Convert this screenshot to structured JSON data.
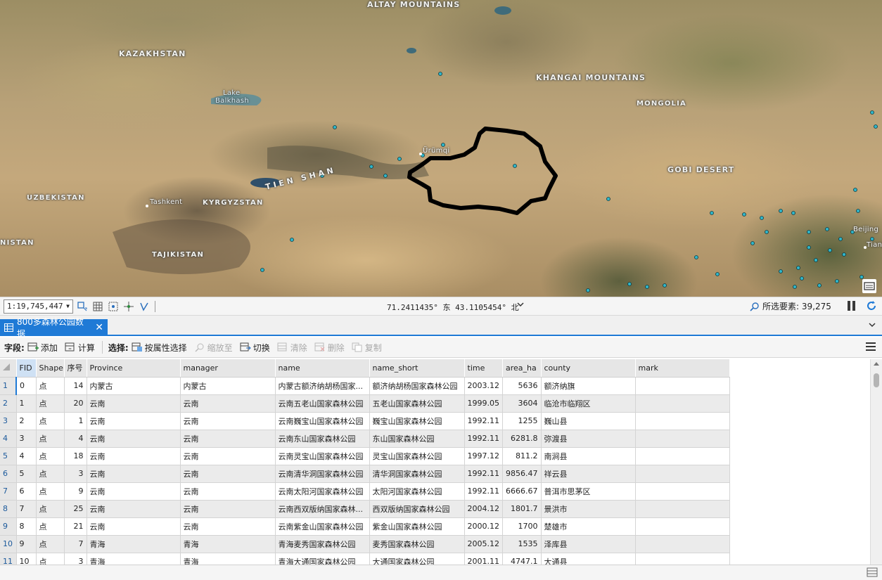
{
  "map": {
    "labels": {
      "altay": "ALTAY MOUNTAINS",
      "kazakhstan": "KAZAKHSTAN",
      "lake_balkhash_1": "Lake",
      "lake_balkhash_2": "Balkhash",
      "khangai": "KHANGAI MOUNTAINS",
      "mongolia": "MONGOLIA",
      "urumqi": "Ürümqi",
      "gobi": "GOBI DESERT",
      "uzbekistan": "UZBEKISTAN",
      "tashkent": "Tashkent",
      "kyrgyzstan": "KYRGYZSTAN",
      "tien_shan": "TIEN SHAN",
      "nistan": "NISTAN",
      "tajikistan": "TAJIKISTAN",
      "beijing": "Beijing",
      "tianjin": "Tianj"
    },
    "point_color": "#2fb6c9",
    "outline_color": "#000000"
  },
  "statusbar": {
    "scale": "1:19,745,447",
    "coordinates": "71.2411435° 东 43.1105454° 北",
    "selected_label": "所选要素: 39,275",
    "icons": [
      "map-layout-icon",
      "grid-icon",
      "snapping-icon",
      "guides-icon",
      "correction-icon"
    ]
  },
  "tab": {
    "title": "800多森林公园数据"
  },
  "toolbar": {
    "fields_label": "字段:",
    "add": "添加",
    "calculate": "计算",
    "select_label": "选择:",
    "select_by_attr": "按属性选择",
    "zoom_to": "缩放至",
    "switch": "切换",
    "clear": "清除",
    "delete": "删除",
    "copy": "复制"
  },
  "table": {
    "columns": [
      "FID",
      "Shape",
      "序号",
      "Province",
      "manager",
      "name",
      "name_short",
      "time",
      "area_ha",
      "county",
      "mark"
    ],
    "rows": [
      [
        "1",
        "0",
        "点",
        "14",
        "内蒙古",
        "内蒙古",
        "内蒙古额济纳胡杨国家...",
        "额济纳胡杨国家森林公园",
        "2003.12",
        "5636",
        "额济纳旗",
        ""
      ],
      [
        "2",
        "1",
        "点",
        "20",
        "云南",
        "云南",
        "云南五老山国家森林公园",
        "五老山国家森林公园",
        "1999.05",
        "3604",
        "临沧市临翔区",
        ""
      ],
      [
        "3",
        "2",
        "点",
        "1",
        "云南",
        "云南",
        "云南巍宝山国家森林公园",
        "巍宝山国家森林公园",
        "1992.11",
        "1255",
        "巍山县",
        ""
      ],
      [
        "4",
        "3",
        "点",
        "4",
        "云南",
        "云南",
        "云南东山国家森林公园",
        "东山国家森林公园",
        "1992.11",
        "6281.8",
        "弥渡县",
        ""
      ],
      [
        "5",
        "4",
        "点",
        "18",
        "云南",
        "云南",
        "云南灵宝山国家森林公园",
        "灵宝山国家森林公园",
        "1997.12",
        "811.2",
        "南涧县",
        ""
      ],
      [
        "6",
        "5",
        "点",
        "3",
        "云南",
        "云南",
        "云南清华洞国家森林公园",
        "清华洞国家森林公园",
        "1992.11",
        "9856.47",
        "祥云县",
        ""
      ],
      [
        "7",
        "6",
        "点",
        "9",
        "云南",
        "云南",
        "云南太阳河国家森林公园",
        "太阳河国家森林公园",
        "1992.11",
        "6666.67",
        "普洱市思茅区",
        ""
      ],
      [
        "8",
        "7",
        "点",
        "25",
        "云南",
        "云南",
        "云南西双版纳国家森林...",
        "西双版纳国家森林公园",
        "2004.12",
        "1801.7",
        "景洪市",
        ""
      ],
      [
        "9",
        "8",
        "点",
        "21",
        "云南",
        "云南",
        "云南紫金山国家森林公园",
        "紫金山国家森林公园",
        "2000.12",
        "1700",
        "楚雄市",
        ""
      ],
      [
        "10",
        "9",
        "点",
        "7",
        "青海",
        "青海",
        "青海麦秀国家森林公园",
        "麦秀国家森林公园",
        "2005.12",
        "1535",
        "泽库县",
        ""
      ],
      [
        "11",
        "10",
        "点",
        "3",
        "青海",
        "青海",
        "青海大通国家森林公园",
        "大通国家森林公园",
        "2001.11",
        "4747.1",
        "大通县",
        ""
      ]
    ]
  }
}
